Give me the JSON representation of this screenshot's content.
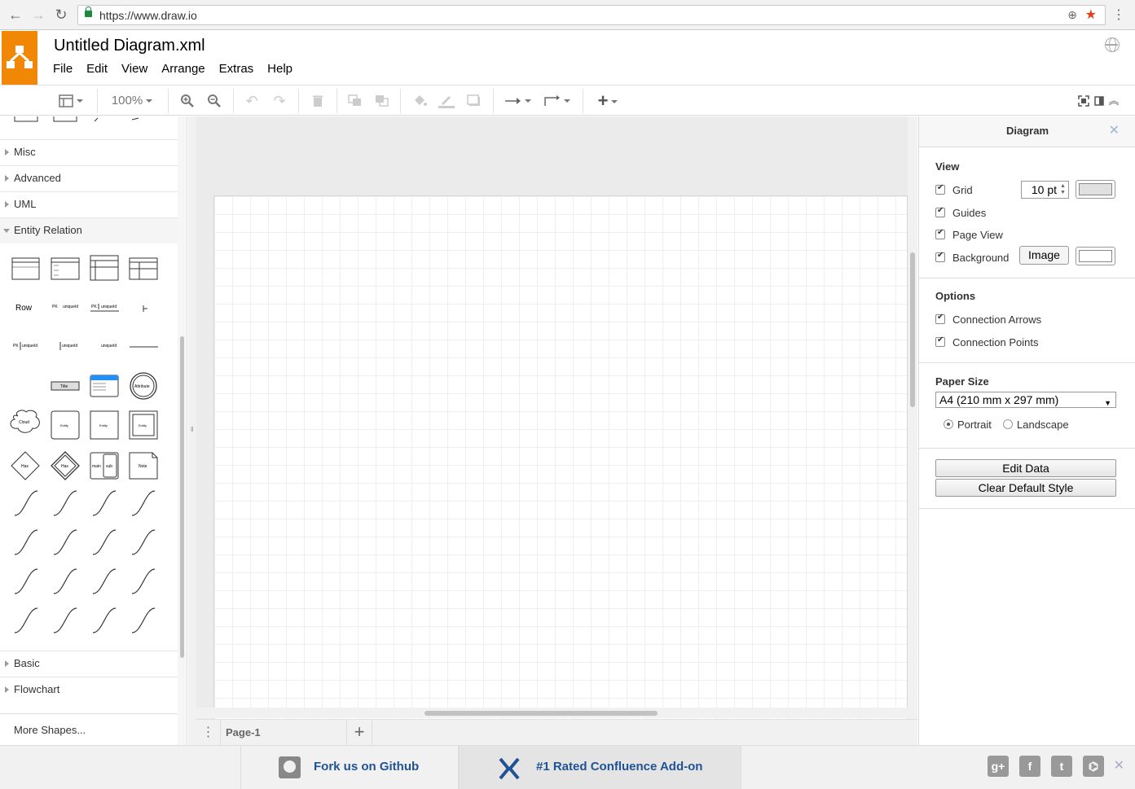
{
  "browser": {
    "url": "https://www.draw.io"
  },
  "app": {
    "title": "Untitled Diagram.xml",
    "menu": [
      "File",
      "Edit",
      "View",
      "Arrange",
      "Extras",
      "Help"
    ]
  },
  "toolbar": {
    "zoom": "100%"
  },
  "sidebar": {
    "sections_top": [
      "Misc",
      "Advanced",
      "UML"
    ],
    "open_section": "Entity Relation",
    "sections_bottom": [
      "Basic",
      "Flowchart"
    ],
    "more_shapes": "More Shapes...",
    "shape_labels": {
      "row": "Row",
      "pk": "PK",
      "uniqueid": "uniqueId",
      "title": "Title",
      "attribute": "Attribute",
      "cloud": "Cloud",
      "entity": "Entity",
      "has": "Has",
      "main": "main",
      "sub": "sub",
      "note": "Note"
    }
  },
  "canvas": {
    "page_tab": "Page-1"
  },
  "format_panel": {
    "header": "Diagram",
    "view_title": "View",
    "grid_label": "Grid",
    "grid_size": "10 pt",
    "guides_label": "Guides",
    "page_view_label": "Page View",
    "background_label": "Background",
    "image_button": "Image",
    "options_title": "Options",
    "connection_arrows_label": "Connection Arrows",
    "connection_points_label": "Connection Points",
    "paper_size_title": "Paper Size",
    "paper_size_value": "A4 (210 mm x 297 mm)",
    "portrait_label": "Portrait",
    "landscape_label": "Landscape",
    "edit_data_button": "Edit Data",
    "clear_style_button": "Clear Default Style",
    "grid_color": "#e0e0e0",
    "background_color": "#ffffff"
  },
  "footer": {
    "github_link": "Fork us on Github",
    "confluence_link": "#1 Rated Confluence Add-on",
    "social_icons": [
      "google-plus-icon",
      "facebook-icon",
      "twitter-icon",
      "github-icon"
    ]
  },
  "colors": {
    "brand_orange": "#f08705",
    "link_blue": "#1f5394"
  }
}
